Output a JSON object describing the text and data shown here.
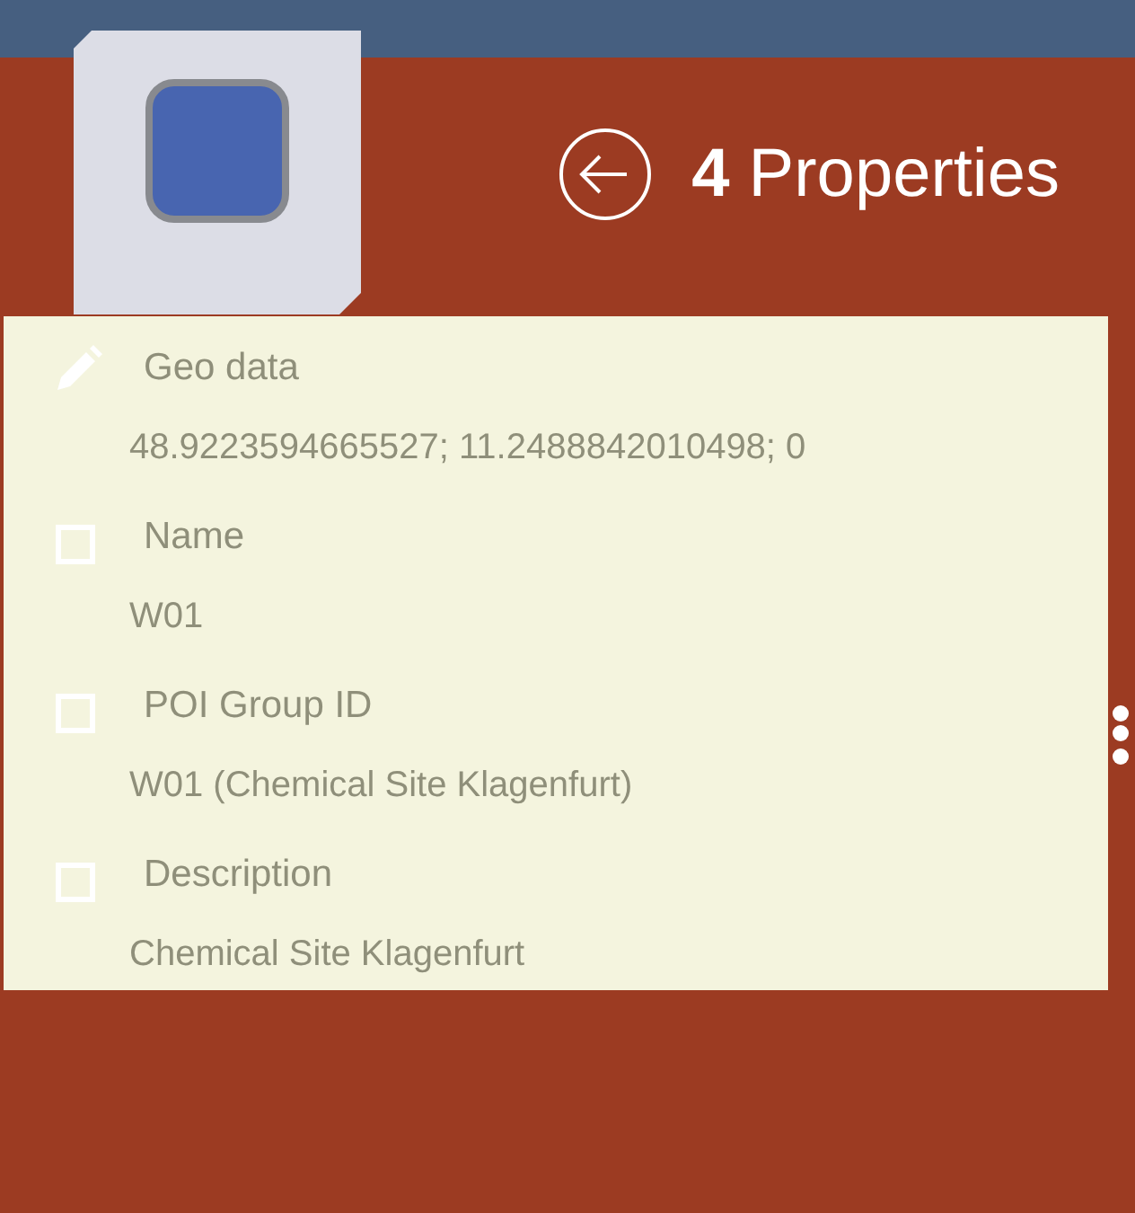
{
  "header": {
    "count": "4",
    "title": "Properties"
  },
  "properties": [
    {
      "kind": "edit",
      "label": "Geo data",
      "value": "48.9223594665527; 11.2488842010498; 0"
    },
    {
      "kind": "checkbox",
      "checked": false,
      "label": "Name",
      "value": "W01"
    },
    {
      "kind": "checkbox",
      "checked": false,
      "label": "POI Group ID",
      "value": "W01 (Chemical Site Klagenfurt)"
    },
    {
      "kind": "checkbox",
      "checked": false,
      "label": "Description",
      "value": "Chemical Site Klagenfurt"
    }
  ]
}
